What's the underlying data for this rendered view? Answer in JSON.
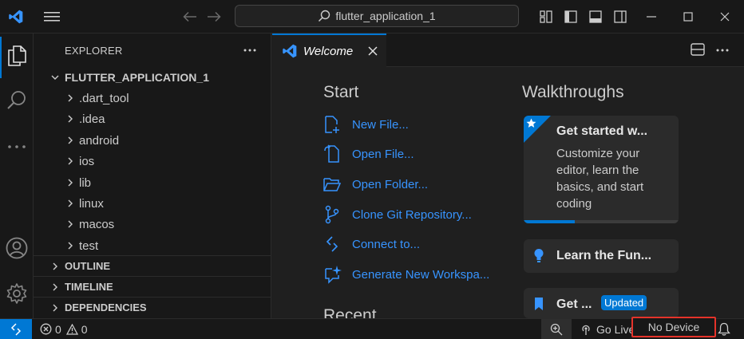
{
  "titlebar": {
    "search_text": "flutter_application_1"
  },
  "sidebar": {
    "header": "EXPLORER",
    "project": "FLUTTER_APPLICATION_1",
    "items": [
      ".dart_tool",
      ".idea",
      "android",
      "ios",
      "lib",
      "linux",
      "macos",
      "test"
    ],
    "sections": [
      "OUTLINE",
      "TIMELINE",
      "DEPENDENCIES"
    ]
  },
  "tab": {
    "label": "Welcome"
  },
  "welcome": {
    "start_title": "Start",
    "start_items": [
      "New File...",
      "Open File...",
      "Open Folder...",
      "Clone Git Repository...",
      "Connect to...",
      "Generate New Workspa..."
    ],
    "recent_title": "Recent",
    "walkthroughs_title": "Walkthroughs",
    "cards": [
      {
        "title": "Get started w...",
        "description": "Customize your editor, learn the basics, and start coding"
      },
      {
        "title": "Learn the Fun..."
      },
      {
        "title": "Get ...",
        "badge": "Updated"
      }
    ]
  },
  "statusbar": {
    "errors": "0",
    "warnings": "0",
    "go_live": "Go Live",
    "device": "No Device"
  },
  "colors": {
    "accent": "#0078d4",
    "link": "#3794ff",
    "highlight_box": "#e5332a"
  }
}
